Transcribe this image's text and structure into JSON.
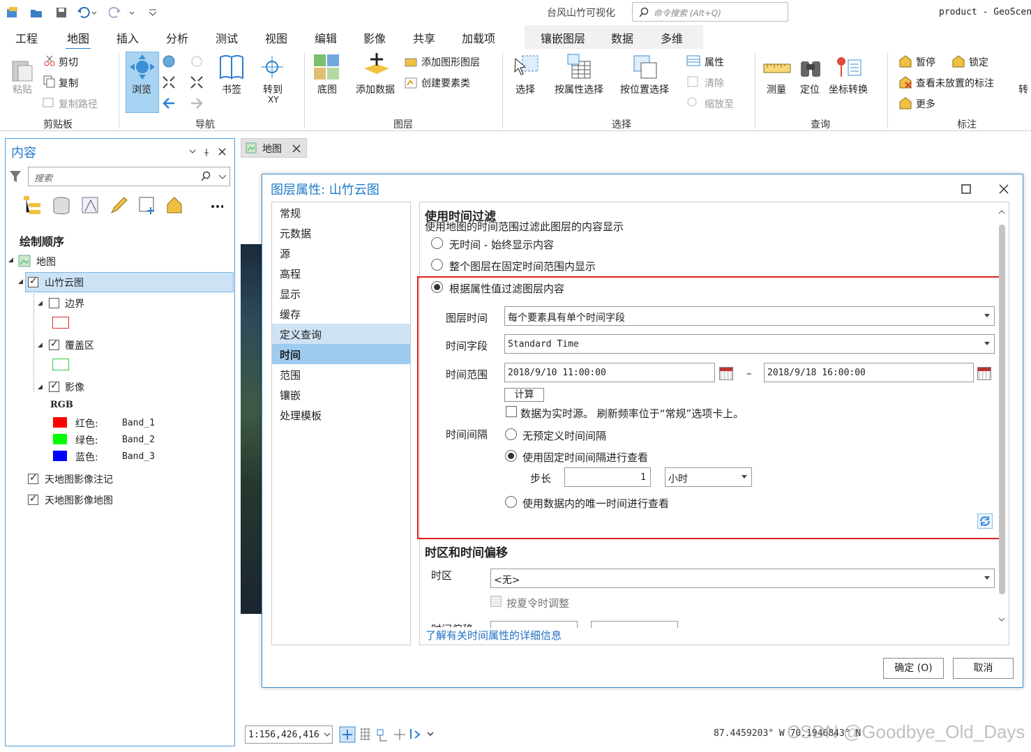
{
  "window": {
    "app_title": "台风山竹可视化",
    "command_search_placeholder": "命令搜索 (Alt+Q)",
    "user": "product - GeoScen"
  },
  "ribbon_tabs": [
    {
      "label": "工程"
    },
    {
      "label": "地图",
      "active": true
    },
    {
      "label": "插入"
    },
    {
      "label": "分析"
    },
    {
      "label": "测试"
    },
    {
      "label": "视图"
    },
    {
      "label": "编辑"
    },
    {
      "label": "影像"
    },
    {
      "label": "共享"
    },
    {
      "label": "加载项"
    },
    {
      "label": "镶嵌图层"
    },
    {
      "label": "数据"
    },
    {
      "label": "多维"
    }
  ],
  "ribbon": {
    "clipboard": {
      "paste": "粘贴",
      "cut": "剪切",
      "copy": "复制",
      "copy_path": "复制路径",
      "group": "剪贴板"
    },
    "navigate": {
      "browse": "浏览",
      "bookmarks": "书签",
      "goto_xy_1": "转到",
      "goto_xy_2": "XY",
      "group": "导航"
    },
    "layer": {
      "basemap": "底图",
      "add_data": "添加数据",
      "add_graphics_layer": "添加图形图层",
      "create_feature_class": "创建要素类",
      "group": "图层"
    },
    "selection": {
      "select": "选择",
      "select_by_attributes": "按属性选择",
      "select_by_location": "按位置选择",
      "attributes": "属性",
      "clear": "清除",
      "zoom_to": "缩放至",
      "group": "选择"
    },
    "inquiry": {
      "measure": "测量",
      "locate": "定位",
      "convert_coordinates": "坐标转换",
      "group": "查询"
    },
    "labeling": {
      "pause": "暂停",
      "lock": "锁定",
      "view_unplaced": "查看未放置的标注",
      "more": "更多",
      "convert": "转",
      "group": "标注"
    }
  },
  "contents": {
    "title": "内容",
    "search_placeholder": "搜索",
    "drawing_order": "绘制顺序",
    "map": "地图",
    "layer_selected": "山竹云图",
    "sublayers": [
      {
        "name": "边界",
        "checked": false,
        "swatch_color": "#e03030",
        "swatch_fill": "#ffffff"
      },
      {
        "name": "覆盖区",
        "checked": true,
        "swatch_color": "#2ecc40",
        "swatch_fill": "#ffffff"
      },
      {
        "name": "影像",
        "checked": true
      }
    ],
    "rgb_label": "RGB",
    "bands": [
      {
        "color_name": "红色:",
        "band": "Band_1",
        "color": "#ff0000"
      },
      {
        "color_name": "绿色:",
        "band": "Band_2",
        "color": "#00ff00"
      },
      {
        "color_name": "蓝色:",
        "band": "Band_3",
        "color": "#0000ff"
      }
    ],
    "other_layers": [
      {
        "name": "天地图影像注记",
        "checked": true
      },
      {
        "name": "天地图影像地图",
        "checked": true
      }
    ]
  },
  "map_tab": {
    "label": "地图"
  },
  "dialog": {
    "title": "图层属性: 山竹云图",
    "nav": [
      {
        "label": "常规"
      },
      {
        "label": "元数据"
      },
      {
        "label": "源"
      },
      {
        "label": "高程"
      },
      {
        "label": "显示"
      },
      {
        "label": "缓存"
      },
      {
        "label": "定义查询",
        "state": "hover"
      },
      {
        "label": "时间",
        "state": "selected"
      },
      {
        "label": "范围"
      },
      {
        "label": "镶嵌"
      },
      {
        "label": "处理模板"
      }
    ],
    "time_filter": {
      "heading": "使用时间过滤",
      "subtitle": "使用地图的时间范围过滤此图层的内容显示",
      "option_no_time": "无时间 - 始终显示内容",
      "option_fixed_range": "整个图层在固定时间范围内显示",
      "option_by_attribute": "根据属性值过滤图层内容",
      "layer_time_label": "图层时间",
      "layer_time_value": "每个要素具有单个时间字段",
      "time_field_label": "时间字段",
      "time_field_value": "Standard Time",
      "time_extent_label": "时间范围",
      "start_time": "2018/9/10 11:00:00",
      "dash": "–",
      "end_time": "2018/9/18 16:00:00",
      "calculate_button": "计算",
      "live_data_text": "数据为实时源。 刷新频率位于“常规”选项卡上。",
      "time_interval_label": "时间间隔",
      "interval_none": "无预定义时间间隔",
      "interval_fixed": "使用固定时间间隔进行查看",
      "step_label": "步长",
      "step_value": "1",
      "step_unit": "小时",
      "interval_unique": "使用数据内的唯一时间进行查看"
    },
    "timezone": {
      "heading": "时区和时间偏移",
      "timezone_label": "时区",
      "timezone_value": "<无>",
      "dst_label": "按夏令时调整",
      "offset_label": "时间偏移"
    },
    "learn_more": "了解有关时间属性的详细信息",
    "ok_button": "确定 (O)",
    "cancel_button": "取消"
  },
  "statusbar": {
    "scale": "1:156,426,416",
    "coordinates": "87.4459203° W  70.1946843° N"
  },
  "watermark": "CSDN @Goodbye_Old_Days",
  "colors": {
    "accent": "#2a7fd4",
    "highlight_box": "#e02020",
    "selected_row": "#cde3f5",
    "nav_selected": "#9fcbef"
  }
}
